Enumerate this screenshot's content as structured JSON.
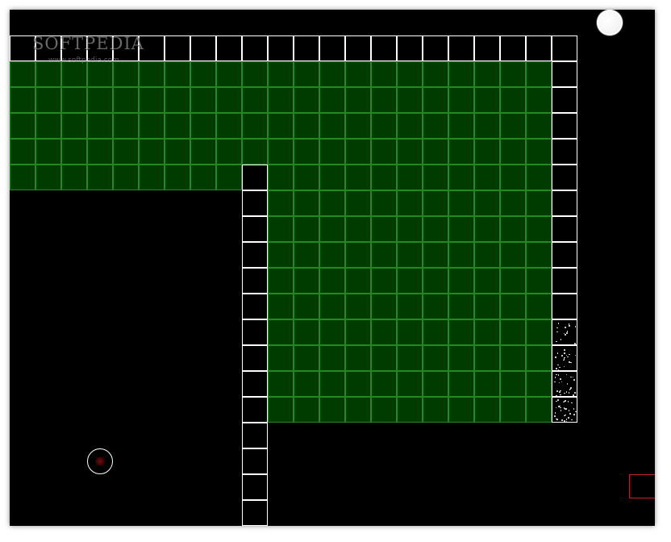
{
  "watermark": {
    "brand": "SOFTPEDIA",
    "url": "www.softpedia.com"
  },
  "colors": {
    "background": "#000000",
    "filled_area": "#003c00",
    "filled_grid_line": "#1f8a1f",
    "wall_outline": "#ffffff",
    "enemy_outline": "#c0202a",
    "ball": "#ffffff"
  },
  "board": {
    "cell_size_units": 1,
    "filled_regions": [
      {
        "col_start": 0,
        "col_end": 20,
        "row_start": 2,
        "row_end": 6
      },
      {
        "col_start": 10,
        "col_end": 20,
        "row_start": 6,
        "row_end": 15
      }
    ],
    "walls": [
      {
        "col_start": 0,
        "col_end": 21,
        "row_start": 1,
        "row_end": 1
      },
      {
        "col_start": 21,
        "col_end": 21,
        "row_start": 2,
        "row_end": 15
      },
      {
        "col_start": 9,
        "col_end": 9,
        "row_start": 6,
        "row_end": 19
      }
    ],
    "static_cells": [
      {
        "col": 21,
        "row": 12
      },
      {
        "col": 21,
        "row": 13
      },
      {
        "col": 21,
        "row": 14
      },
      {
        "col": 21,
        "row": 15
      }
    ]
  },
  "entities": {
    "bounce_ball": "ball-icon",
    "player": "player-marker-icon",
    "enemy": "enemy-square-icon"
  }
}
